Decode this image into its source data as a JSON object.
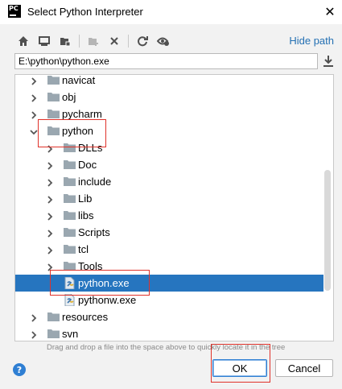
{
  "window": {
    "app_icon_text": "PC",
    "title": "Select Python Interpreter",
    "close_glyph": "✕"
  },
  "toolbar": {
    "buttons": [
      {
        "name": "home-icon"
      },
      {
        "name": "desktop-icon"
      },
      {
        "name": "project-folder-icon"
      },
      {
        "name": "new-folder-icon"
      },
      {
        "name": "delete-icon"
      },
      {
        "name": "refresh-icon"
      },
      {
        "name": "show-hidden-icon"
      }
    ],
    "hide_path_label": "Hide path"
  },
  "path": {
    "value": "E:\\python\\python.exe"
  },
  "tree": {
    "items": [
      {
        "label": "navicat",
        "type": "folder",
        "expanded": false,
        "depth": 1
      },
      {
        "label": "obj",
        "type": "folder",
        "expanded": false,
        "depth": 1
      },
      {
        "label": "pycharm",
        "type": "folder",
        "expanded": false,
        "depth": 1
      },
      {
        "label": "python",
        "type": "folder",
        "expanded": true,
        "depth": 1
      },
      {
        "label": "DLLs",
        "type": "folder",
        "expanded": false,
        "depth": 2
      },
      {
        "label": "Doc",
        "type": "folder",
        "expanded": false,
        "depth": 2
      },
      {
        "label": "include",
        "type": "folder",
        "expanded": false,
        "depth": 2
      },
      {
        "label": "Lib",
        "type": "folder",
        "expanded": false,
        "depth": 2
      },
      {
        "label": "libs",
        "type": "folder",
        "expanded": false,
        "depth": 2
      },
      {
        "label": "Scripts",
        "type": "folder",
        "expanded": false,
        "depth": 2
      },
      {
        "label": "tcl",
        "type": "folder",
        "expanded": false,
        "depth": 2
      },
      {
        "label": "Tools",
        "type": "folder",
        "expanded": false,
        "depth": 2
      },
      {
        "label": "python.exe",
        "type": "file",
        "selected": true,
        "depth": 2
      },
      {
        "label": "pythonw.exe",
        "type": "file",
        "selected": false,
        "depth": 2
      },
      {
        "label": "resources",
        "type": "folder",
        "expanded": false,
        "depth": 1
      },
      {
        "label": "svn",
        "type": "folder",
        "expanded": false,
        "depth": 1
      }
    ],
    "hint": "Drag and drop a file into the space above to quickly locate it in the tree"
  },
  "footer": {
    "help_glyph": "?",
    "ok_label": "OK",
    "cancel_label": "Cancel"
  },
  "colors": {
    "selection": "#2675bf",
    "link": "#2470b3",
    "folder": "#9aa7b0",
    "annotation": "#e0322a"
  }
}
